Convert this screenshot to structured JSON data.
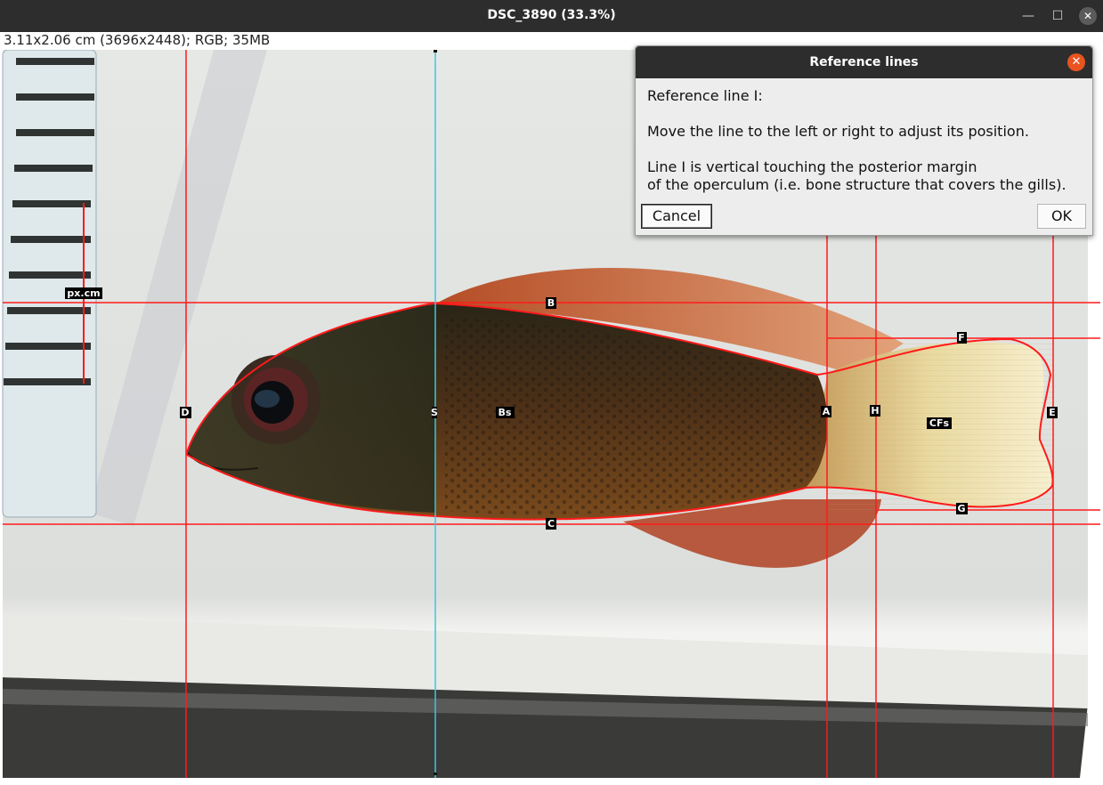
{
  "window": {
    "title": "DSC_3890 (33.3%)",
    "minimize_glyph": "—",
    "maximize_glyph": "☐",
    "close_glyph": "✕"
  },
  "image_info": "3.11x2.06 cm (3696x2448); RGB; 35MB",
  "landmarks": {
    "px_cm": "px.cm",
    "B": "B",
    "C": "C",
    "D": "D",
    "Bs": "Bs",
    "S": "S",
    "A": "A",
    "H": "H",
    "F": "F",
    "G": "G",
    "CFs": "CFs",
    "E": "E"
  },
  "dialog": {
    "title": "Reference lines",
    "close_glyph": "✕",
    "line1": "Reference line I:",
    "line2": "Move the line to the left or right to adjust its position.",
    "line3": "Line I is vertical touching the posterior margin",
    "line4": "of the operculum (i.e. bone structure that covers the gills).",
    "cancel_label": "Cancel",
    "ok_label": "OK"
  },
  "colors": {
    "reference_line": "#ff1a1a",
    "active_line": "#3ec8d8",
    "title_bar": "#2d2d2d",
    "dialog_close": "#e95420"
  }
}
